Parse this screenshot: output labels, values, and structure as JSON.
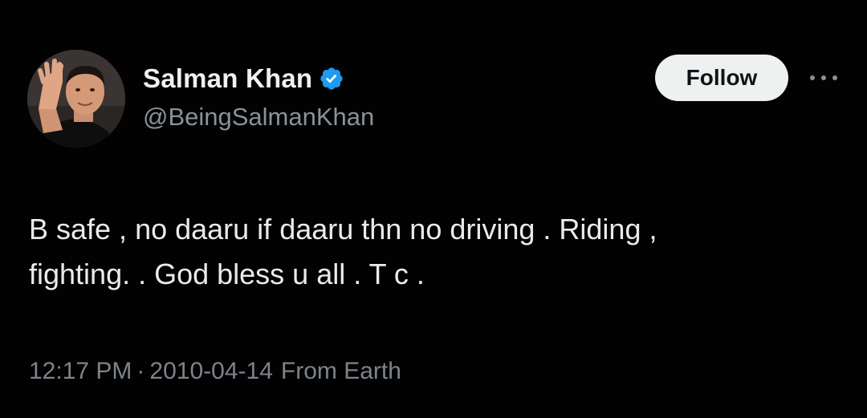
{
  "author": {
    "display_name": "Salman Khan",
    "handle": "@BeingSalmanKhan",
    "verified": true,
    "verified_icon": "verified-badge-icon",
    "avatar": "profile-photo"
  },
  "actions": {
    "follow_label": "Follow",
    "more_icon": "more-horizontal-icon"
  },
  "tweet": {
    "text": "B safe , no daaru if daaru thn no driving . Riding ,\nfighting. . God bless u all . T c .",
    "time": "12:17 PM",
    "separator": "·",
    "date": "2010-04-14",
    "source": "From Earth"
  },
  "colors": {
    "background": "#020202",
    "text": "#e9ebec",
    "muted": "#7d838a",
    "verified_blue": "#1d9bf0",
    "button_bg": "#eff1f1"
  }
}
